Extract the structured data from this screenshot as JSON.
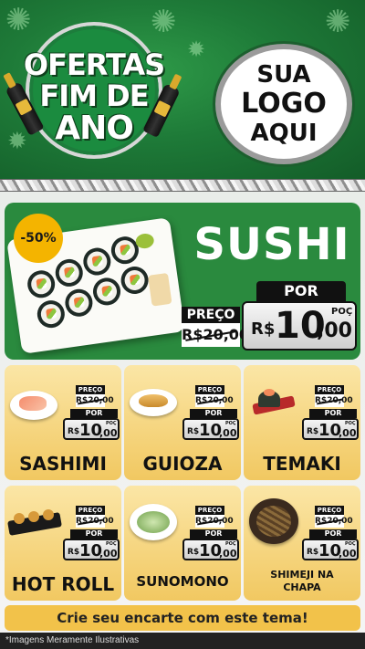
{
  "header": {
    "badge_line1": "OFERTAS",
    "badge_line2": "FIM DE",
    "badge_line3": "ANO",
    "logo_line1": "SUA",
    "logo_line2": "LOGO",
    "logo_line3": "AQUI"
  },
  "hero": {
    "discount": "-50%",
    "title": "SUSHI",
    "preco_label": "PREÇO",
    "old_price": "R$20,00",
    "por_label": "POR",
    "new_price_currency": "R$",
    "new_price_main": "10",
    "new_price_cents": ",00",
    "poc": "POÇ"
  },
  "products": [
    {
      "name": "SASHIMI",
      "preco_label": "PREÇO",
      "old_price": "R$20,00",
      "por_label": "POR",
      "currency": "R$",
      "main": "10",
      "cents": ",00",
      "poc": "POÇ"
    },
    {
      "name": "GUIOZA",
      "preco_label": "PREÇO",
      "old_price": "R$20,00",
      "por_label": "POR",
      "currency": "R$",
      "main": "10",
      "cents": ",00",
      "poc": "POÇ"
    },
    {
      "name": "TEMAKI",
      "preco_label": "PREÇO",
      "old_price": "R$20,00",
      "por_label": "POR",
      "currency": "R$",
      "main": "10",
      "cents": ",00",
      "poc": "POÇ"
    },
    {
      "name": "HOT ROLL",
      "preco_label": "PREÇO",
      "old_price": "R$20,00",
      "por_label": "POR",
      "currency": "R$",
      "main": "10",
      "cents": ",00",
      "poc": "POÇ"
    },
    {
      "name": "SUNOMONO",
      "preco_label": "PREÇO",
      "old_price": "R$20,00",
      "por_label": "POR",
      "currency": "R$",
      "main": "10",
      "cents": ",00",
      "poc": "POÇ"
    },
    {
      "name_line1": "SHIMEJI NA",
      "name_line2": "CHAPA",
      "preco_label": "PREÇO",
      "old_price": "R$20,00",
      "por_label": "POR",
      "currency": "R$",
      "main": "10",
      "cents": ",00",
      "poc": "POÇ"
    }
  ],
  "footer": {
    "cta": "Crie seu encarte com este tema!",
    "note": "*Imagens Meramente Ilustrativas"
  },
  "colors": {
    "header_green": "#1e7a38",
    "hero_green": "#2a8a3e",
    "card_gold": "#f1c861",
    "discount_yellow": "#f4b400"
  }
}
